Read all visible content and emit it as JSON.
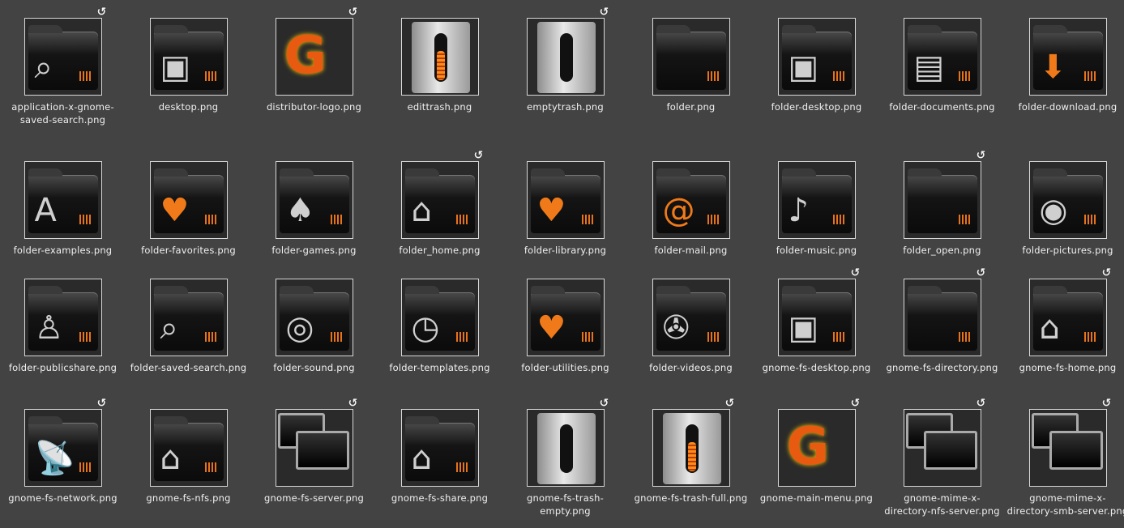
{
  "items": [
    {
      "label": "application-x-gnome-saved-search.png",
      "link": true,
      "kind": "folder",
      "glyph": "⌕"
    },
    {
      "label": "desktop.png",
      "link": false,
      "kind": "folder",
      "glyph": "▣"
    },
    {
      "label": "distributor-logo.png",
      "link": true,
      "kind": "gnome",
      "glyph": "G"
    },
    {
      "label": "edittrash.png",
      "link": false,
      "kind": "trash-full",
      "glyph": ""
    },
    {
      "label": "emptytrash.png",
      "link": true,
      "kind": "trash",
      "glyph": ""
    },
    {
      "label": "folder.png",
      "link": false,
      "kind": "folder",
      "glyph": ""
    },
    {
      "label": "folder-desktop.png",
      "link": false,
      "kind": "folder",
      "glyph": "▣"
    },
    {
      "label": "folder-documents.png",
      "link": false,
      "kind": "folder",
      "glyph": "▤"
    },
    {
      "label": "folder-download.png",
      "link": false,
      "kind": "folder",
      "glyph": "⬇"
    },
    {
      "label": "folder-examples.png",
      "link": false,
      "kind": "folder",
      "glyph": "A"
    },
    {
      "label": "folder-favorites.png",
      "link": false,
      "kind": "folder",
      "glyph": "♥"
    },
    {
      "label": "folder-games.png",
      "link": false,
      "kind": "folder",
      "glyph": "♠"
    },
    {
      "label": "folder_home.png",
      "link": true,
      "kind": "folder",
      "glyph": "⌂"
    },
    {
      "label": "folder-library.png",
      "link": false,
      "kind": "folder",
      "glyph": "♥"
    },
    {
      "label": "folder-mail.png",
      "link": false,
      "kind": "folder",
      "glyph": "@"
    },
    {
      "label": "folder-music.png",
      "link": false,
      "kind": "folder",
      "glyph": "♪"
    },
    {
      "label": "folder_open.png",
      "link": true,
      "kind": "folder",
      "glyph": ""
    },
    {
      "label": "folder-pictures.png",
      "link": false,
      "kind": "folder",
      "glyph": "◉"
    },
    {
      "label": "folder-publicshare.png",
      "link": false,
      "kind": "folder",
      "glyph": "♙"
    },
    {
      "label": "folder-saved-search.png",
      "link": false,
      "kind": "folder",
      "glyph": "⌕"
    },
    {
      "label": "folder-sound.png",
      "link": false,
      "kind": "folder",
      "glyph": "◎"
    },
    {
      "label": "folder-templates.png",
      "link": false,
      "kind": "folder",
      "glyph": "◷"
    },
    {
      "label": "folder-utilities.png",
      "link": false,
      "kind": "folder",
      "glyph": "♥"
    },
    {
      "label": "folder-videos.png",
      "link": false,
      "kind": "folder",
      "glyph": "✇"
    },
    {
      "label": "gnome-fs-desktop.png",
      "link": true,
      "kind": "folder",
      "glyph": "▣"
    },
    {
      "label": "gnome-fs-directory.png",
      "link": true,
      "kind": "folder",
      "glyph": ""
    },
    {
      "label": "gnome-fs-home.png",
      "link": true,
      "kind": "folder",
      "glyph": "⌂"
    },
    {
      "label": "gnome-fs-network.png",
      "link": true,
      "kind": "folder",
      "glyph": "📡"
    },
    {
      "label": "gnome-fs-nfs.png",
      "link": false,
      "kind": "folder",
      "glyph": "⌂"
    },
    {
      "label": "gnome-fs-server.png",
      "link": true,
      "kind": "monitors",
      "glyph": ""
    },
    {
      "label": "gnome-fs-share.png",
      "link": false,
      "kind": "folder",
      "glyph": "⌂"
    },
    {
      "label": "gnome-fs-trash-empty.png",
      "link": true,
      "kind": "trash",
      "glyph": ""
    },
    {
      "label": "gnome-fs-trash-full.png",
      "link": true,
      "kind": "trash-full",
      "glyph": ""
    },
    {
      "label": "gnome-main-menu.png",
      "link": true,
      "kind": "gnome",
      "glyph": "G"
    },
    {
      "label": "gnome-mime-x-directory-nfs-server.png",
      "link": true,
      "kind": "monitors",
      "glyph": ""
    },
    {
      "label": "gnome-mime-x-directory-smb-server.png",
      "link": true,
      "kind": "monitors",
      "glyph": ""
    }
  ],
  "icons": {
    "link_badge": "↺"
  }
}
